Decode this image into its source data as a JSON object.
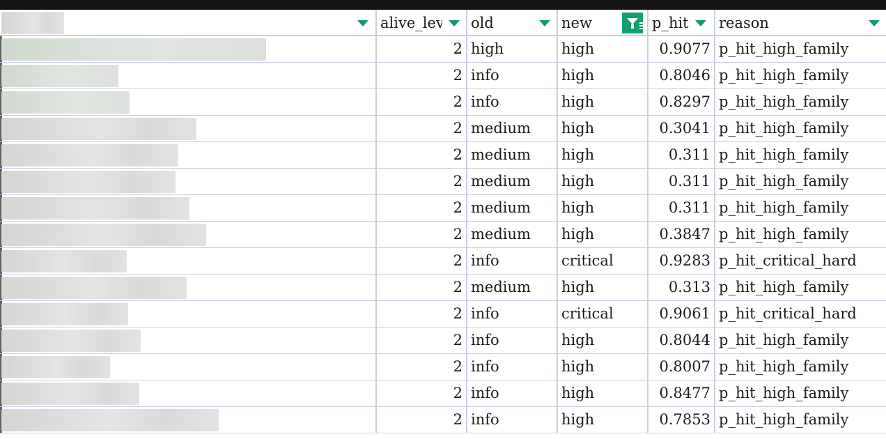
{
  "columns": [
    {
      "label": "",
      "filter_active": false
    },
    {
      "label": "alive_level",
      "filter_active": false
    },
    {
      "label": "old",
      "filter_active": false
    },
    {
      "label": "new",
      "filter_active": true
    },
    {
      "label": "p_hit",
      "filter_active": false
    },
    {
      "label": "reason",
      "filter_active": false
    }
  ],
  "icons": {
    "dropdown": "dropdown-arrow-icon",
    "filter_active": "filter-active-icon"
  },
  "colors": {
    "accent": "#12a072",
    "grid": "#c9cfe2",
    "topbar": "#141414"
  },
  "rows": [
    {
      "alive_level": "2",
      "old": "high",
      "new": "high",
      "p_hit": "0.9077",
      "reason": "p_hit_high_family"
    },
    {
      "alive_level": "2",
      "old": "info",
      "new": "high",
      "p_hit": "0.8046",
      "reason": "p_hit_high_family"
    },
    {
      "alive_level": "2",
      "old": "info",
      "new": "high",
      "p_hit": "0.8297",
      "reason": "p_hit_high_family"
    },
    {
      "alive_level": "2",
      "old": "medium",
      "new": "high",
      "p_hit": "0.3041",
      "reason": "p_hit_high_family"
    },
    {
      "alive_level": "2",
      "old": "medium",
      "new": "high",
      "p_hit": "0.311",
      "reason": "p_hit_high_family"
    },
    {
      "alive_level": "2",
      "old": "medium",
      "new": "high",
      "p_hit": "0.311",
      "reason": "p_hit_high_family"
    },
    {
      "alive_level": "2",
      "old": "medium",
      "new": "high",
      "p_hit": "0.311",
      "reason": "p_hit_high_family"
    },
    {
      "alive_level": "2",
      "old": "medium",
      "new": "high",
      "p_hit": "0.3847",
      "reason": "p_hit_high_family"
    },
    {
      "alive_level": "2",
      "old": "info",
      "new": "critical",
      "p_hit": "0.9283",
      "reason": "p_hit_critical_hard"
    },
    {
      "alive_level": "2",
      "old": "medium",
      "new": "high",
      "p_hit": "0.313",
      "reason": "p_hit_high_family"
    },
    {
      "alive_level": "2",
      "old": "info",
      "new": "critical",
      "p_hit": "0.9061",
      "reason": "p_hit_critical_hard"
    },
    {
      "alive_level": "2",
      "old": "info",
      "new": "high",
      "p_hit": "0.8044",
      "reason": "p_hit_high_family"
    },
    {
      "alive_level": "2",
      "old": "info",
      "new": "high",
      "p_hit": "0.8007",
      "reason": "p_hit_high_family"
    },
    {
      "alive_level": "2",
      "old": "info",
      "new": "high",
      "p_hit": "0.8477",
      "reason": "p_hit_high_family"
    },
    {
      "alive_level": "2",
      "old": "info",
      "new": "high",
      "p_hit": "0.7853",
      "reason": "p_hit_high_family"
    }
  ]
}
